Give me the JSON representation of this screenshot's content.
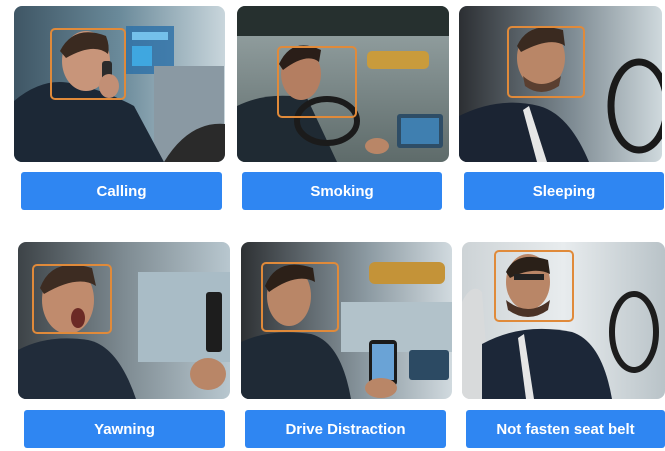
{
  "accent_color": "#2f86f2",
  "detection_box_color": "#e08a3a",
  "behaviors": [
    {
      "label": "Calling",
      "icon": "driver-calling-photo"
    },
    {
      "label": "Smoking",
      "icon": "driver-smoking-photo"
    },
    {
      "label": "Sleeping",
      "icon": "driver-sleeping-photo"
    },
    {
      "label": "Yawning",
      "icon": "driver-yawning-photo"
    },
    {
      "label": "Drive Distraction",
      "icon": "driver-distraction-photo"
    },
    {
      "label": "Not fasten seat belt",
      "icon": "driver-no-seatbelt-photo"
    }
  ]
}
